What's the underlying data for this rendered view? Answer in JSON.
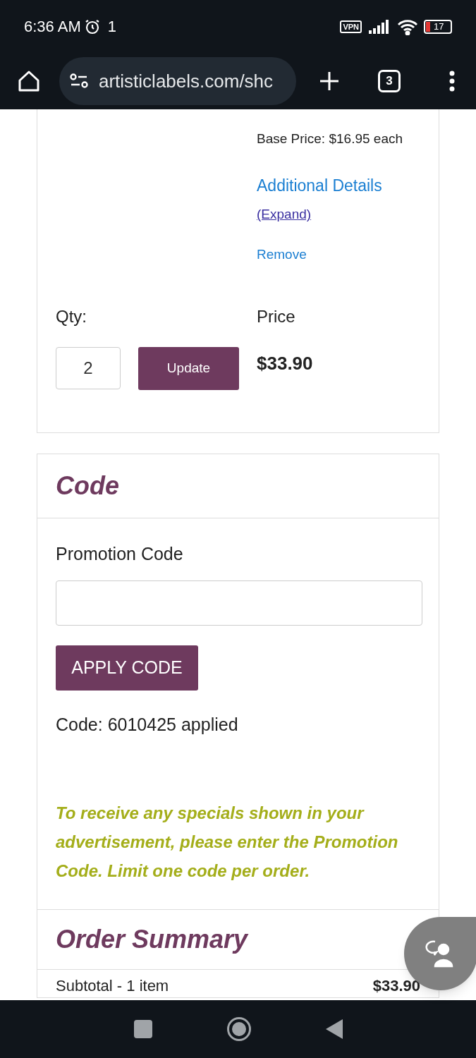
{
  "status_bar": {
    "time": "6:36 AM",
    "notification": "1",
    "vpn": "VPN",
    "battery": {
      "reading": "17",
      "level": 0.17
    }
  },
  "browser": {
    "url": "artisticlabels.com/shc",
    "tab_count": "3"
  },
  "cart_item": {
    "base_price": "Base Price: $16.95 each",
    "details_link": "Additional Details",
    "expand_link": "(Expand)",
    "remove_link": "Remove",
    "qty_label": "Qty:",
    "qty_value": "2",
    "update_button": "Update",
    "price_label": "Price",
    "price": "$33.90"
  },
  "code_section": {
    "title": "Code",
    "field_label": "Promotion Code",
    "apply_button": "APPLY CODE",
    "applied_message": "Code: 6010425 applied",
    "note": "To receive any specials shown in your advertisement, please enter the Promotion Code. Limit one code per order."
  },
  "order_summary": {
    "title": "Order Summary",
    "subtotal_label": "Subtotal - 1 item",
    "subtotal_value": "$33.90"
  }
}
